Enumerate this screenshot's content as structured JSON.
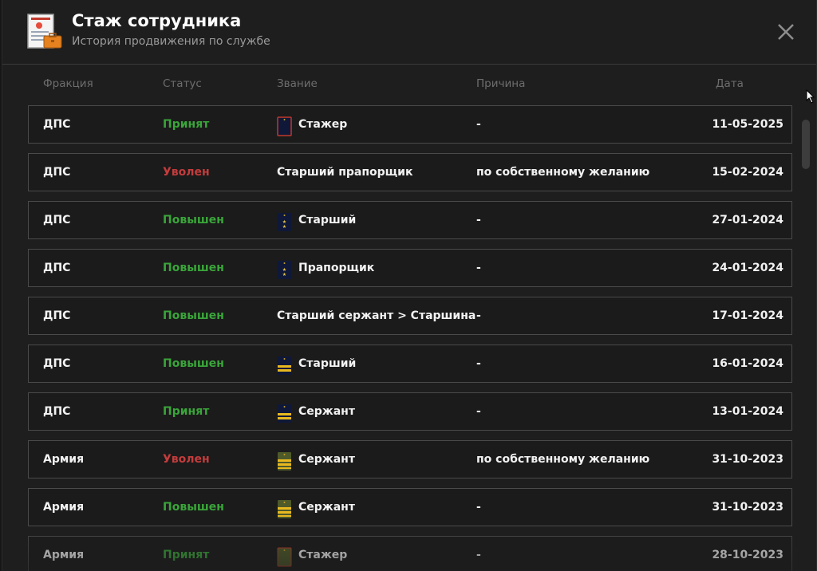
{
  "header": {
    "title": "Стаж сотрудника",
    "subtitle": "История продвижения по службе",
    "app_icon": "document-briefcase-icon",
    "close_icon": "close-icon"
  },
  "columns": {
    "faction": "Фракция",
    "status": "Статус",
    "rank": "Звание",
    "reason": "Причина",
    "date": "Дата"
  },
  "colors": {
    "status_green": "#3aa53a",
    "status_red": "#c43c3c",
    "navy_insignia": "#0f1838",
    "army_insignia": "#4e5a2a"
  },
  "rows": [
    {
      "faction": "ДПС",
      "status": "Принят",
      "status_color": "green",
      "rank": "Стажер",
      "rank_icon": "epaulette-navy-red-icon",
      "reason": "-",
      "date": "11-05-2025"
    },
    {
      "faction": "ДПС",
      "status": "Уволен",
      "status_color": "red",
      "rank": "Старший прапорщик",
      "rank_icon": "",
      "reason": "по собственному желанию",
      "date": "15-02-2024"
    },
    {
      "faction": "ДПС",
      "status": "Повышен",
      "status_color": "green",
      "rank": "Старший",
      "rank_icon": "epaulette-navy-stars-icon",
      "reason": "-",
      "date": "27-01-2024"
    },
    {
      "faction": "ДПС",
      "status": "Повышен",
      "status_color": "green",
      "rank": "Прапорщик",
      "rank_icon": "epaulette-navy-stars-icon",
      "reason": "-",
      "date": "24-01-2024"
    },
    {
      "faction": "ДПС",
      "status": "Повышен",
      "status_color": "green",
      "rank": "Старший сержант > Старшина",
      "rank_icon": "",
      "reason": "-",
      "date": "17-01-2024"
    },
    {
      "faction": "ДПС",
      "status": "Повышен",
      "status_color": "green",
      "rank": "Старший",
      "rank_icon": "epaulette-navy-stripes-icon",
      "reason": "-",
      "date": "16-01-2024"
    },
    {
      "faction": "ДПС",
      "status": "Принят",
      "status_color": "green",
      "rank": "Сержант",
      "rank_icon": "epaulette-navy-stripes-icon",
      "reason": "-",
      "date": "13-01-2024"
    },
    {
      "faction": "Армия",
      "status": "Уволен",
      "status_color": "red",
      "rank": "Сержант",
      "rank_icon": "epaulette-army-stripes-icon",
      "reason": "по собственному желанию",
      "date": "31-10-2023"
    },
    {
      "faction": "Армия",
      "status": "Повышен",
      "status_color": "green",
      "rank": "Сержант",
      "rank_icon": "epaulette-army-stripes-icon",
      "reason": "-",
      "date": "31-10-2023"
    },
    {
      "faction": "Армия",
      "status": "Принят",
      "status_color": "green",
      "rank": "Стажер",
      "rank_icon": "epaulette-army-plain-icon",
      "reason": "-",
      "date": "28-10-2023"
    }
  ]
}
